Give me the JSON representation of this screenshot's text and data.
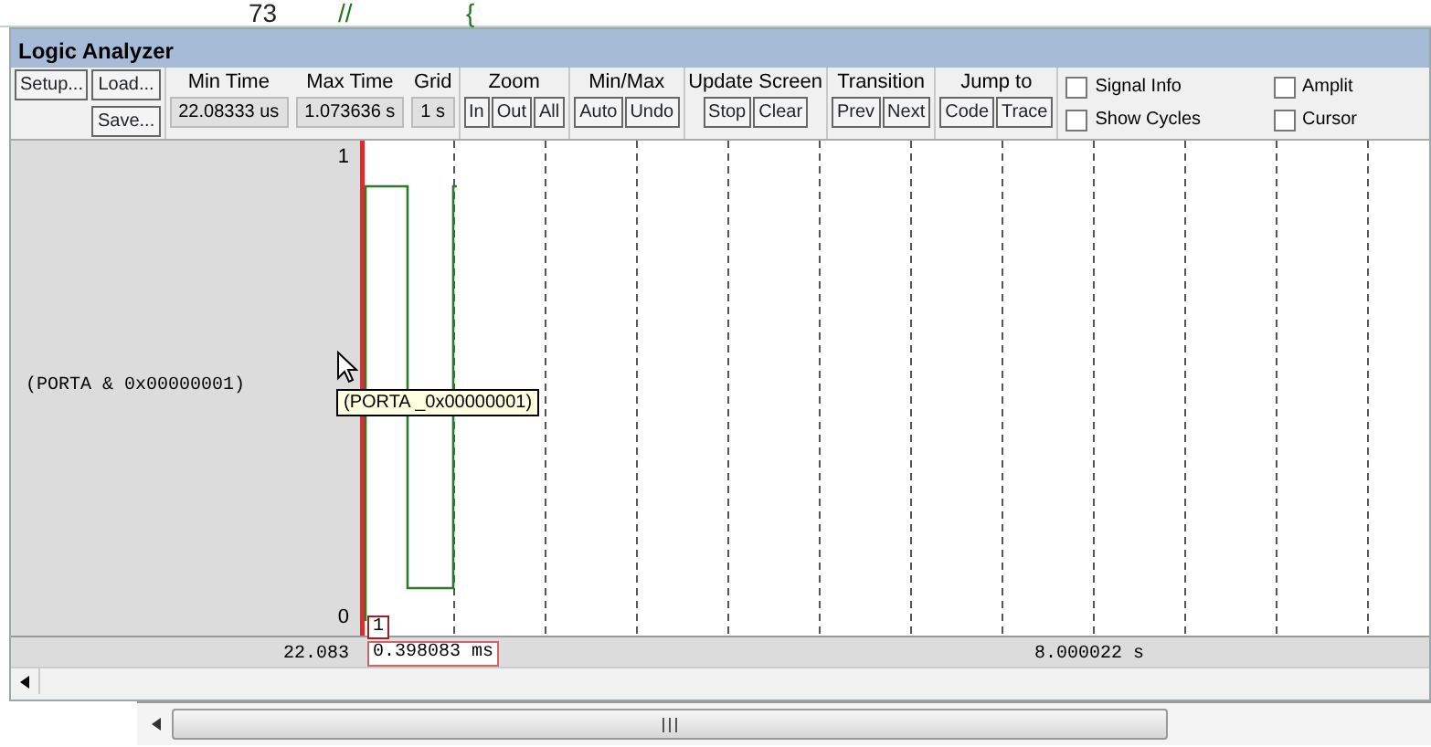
{
  "editor": {
    "line_number": "73",
    "code": [
      "//",
      "{"
    ]
  },
  "window": {
    "title": "Logic Analyzer"
  },
  "file_buttons": [
    "Setup...",
    "Load...",
    "Save..."
  ],
  "fields": [
    {
      "label": "Min Time",
      "value": "22.08333 us"
    },
    {
      "label": "Max Time",
      "value": "1.073636 s"
    },
    {
      "label": "Grid",
      "value": "1 s"
    }
  ],
  "groups": [
    {
      "title": "Zoom",
      "buttons": [
        "In",
        "Out",
        "All"
      ]
    },
    {
      "title": "Min/Max",
      "buttons": [
        "Auto",
        "Undo"
      ]
    },
    {
      "title": "Update Screen",
      "buttons": [
        "Stop",
        "Clear"
      ]
    },
    {
      "title": "Transition",
      "buttons": [
        "Prev",
        "Next"
      ]
    },
    {
      "title": "Jump to",
      "buttons": [
        "Code",
        "Trace"
      ]
    }
  ],
  "checkboxes": [
    {
      "label": "Signal Info",
      "checked": false
    },
    {
      "label": "Amplit",
      "checked": false
    },
    {
      "label": "Show Cycles",
      "checked": false
    },
    {
      "label": "Cursor",
      "checked": false
    }
  ],
  "signal": {
    "name": "(PORTA & 0x00000001)",
    "high_label": "1",
    "low_label": "0",
    "tooltip": "(PORTA _0x00000001)"
  },
  "axis": {
    "start": "22.083",
    "cursor_marker": "1",
    "cursor_time": "0.398083 ms",
    "end": "8.000022 s"
  }
}
